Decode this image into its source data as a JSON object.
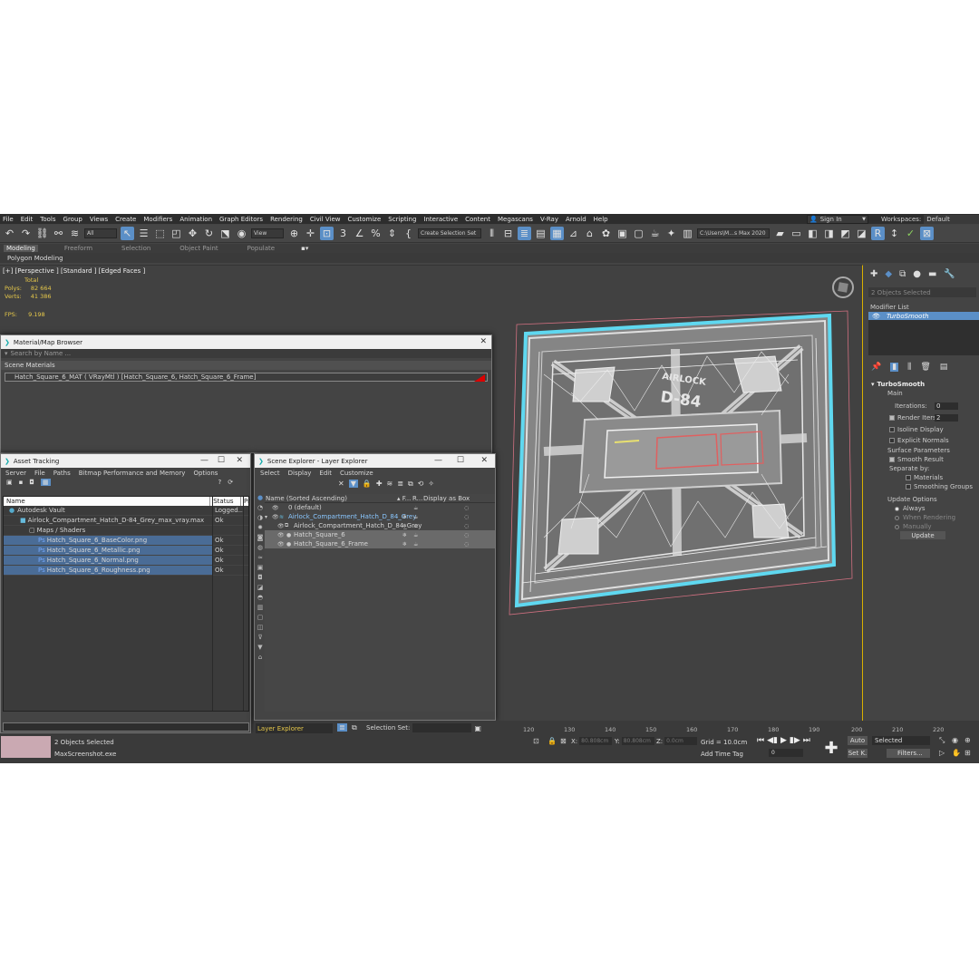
{
  "menu": [
    "File",
    "Edit",
    "Tools",
    "Group",
    "Views",
    "Create",
    "Modifiers",
    "Animation",
    "Graph Editors",
    "Rendering",
    "Civil View",
    "Customize",
    "Scripting",
    "Interactive",
    "Content",
    "Megascans",
    "V-Ray",
    "Arnold",
    "Help"
  ],
  "account": {
    "signin": "Sign In",
    "workspaces_label": "Workspaces:",
    "workspace": "Default"
  },
  "toolbar": {
    "filter_value": "All",
    "view_value": "View",
    "selection_set_placeholder": "Create Selection Set",
    "project_path": "C:\\Users\\M...s Max 2020"
  },
  "ribbon": {
    "tabs": [
      "Modeling",
      "Freeform",
      "Selection",
      "Object Paint",
      "Populate"
    ],
    "panel": "Polygon Modeling"
  },
  "viewport": {
    "label": "[+] [Perspective ] [Standard ] [Edged Faces ]",
    "stats": {
      "total_label": "Total",
      "polys_label": "Polys:",
      "polys": "82 664",
      "verts_label": "Verts:",
      "verts": "41 386"
    },
    "fps_label": "FPS:",
    "fps": "9.198",
    "model_text_1": "AIRLOCK",
    "model_text_2": "D-84"
  },
  "material_browser": {
    "title": "Material/Map Browser",
    "search_placeholder": "Search by Name ...",
    "section": "Scene Materials",
    "item": "Hatch_Square_6_MAT  ( VRayMtl )  [Hatch_Square_6, Hatch_Square_6_Frame]"
  },
  "asset_tracking": {
    "title": "Asset Tracking",
    "menu": [
      "Server",
      "File",
      "Paths",
      "Bitmap Performance and Memory",
      "Options"
    ],
    "columns": [
      "Name",
      "Status",
      "Pr"
    ],
    "rows": [
      {
        "name": "Autodesk Vault",
        "status": "Logged..."
      },
      {
        "name": "Airlock_Compartment_Hatch_D-84_Grey_max_vray.max",
        "status": "Ok"
      },
      {
        "name": "Maps / Shaders",
        "status": ""
      },
      {
        "name": "Hatch_Square_6_BaseColor.png",
        "status": "Ok"
      },
      {
        "name": "Hatch_Square_6_Metallic.png",
        "status": "Ok"
      },
      {
        "name": "Hatch_Square_6_Normal.png",
        "status": "Ok"
      },
      {
        "name": "Hatch_Square_6_Roughness.png",
        "status": "Ok"
      }
    ]
  },
  "scene_explorer": {
    "title": "Scene Explorer - Layer Explorer",
    "menu": [
      "Select",
      "Display",
      "Edit",
      "Customize"
    ],
    "columns": [
      "Name (Sorted Ascending)",
      "▴ F...",
      "R...",
      "Display as Box"
    ],
    "rows": [
      {
        "name": "0 (default)"
      },
      {
        "name": "Airlock_Compartment_Hatch_D_84_Grey"
      },
      {
        "name": "Airlock_Compartment_Hatch_D_84_Grey"
      },
      {
        "name": "Hatch_Square_6"
      },
      {
        "name": "Hatch_Square_6_Frame"
      }
    ],
    "footer_label": "Layer Explorer",
    "selection_set_label": "Selection Set:"
  },
  "command_panel": {
    "selection": "2 Objects Selected",
    "modifier_list": "Modifier List",
    "stack_item": "TurboSmooth",
    "rollout_title": "TurboSmooth",
    "main_label": "Main",
    "iterations_label": "Iterations:",
    "iterations": "0",
    "render_iters_label": "Render Iters:",
    "render_iters": "2",
    "isoline": "Isoline Display",
    "explicit": "Explicit Normals",
    "surface_params": "Surface Parameters",
    "smooth_result": "Smooth Result",
    "separate_by": "Separate by:",
    "materials": "Materials",
    "smoothing_groups": "Smoothing Groups",
    "update_options": "Update Options",
    "always": "Always",
    "when_rendering": "When Rendering",
    "manually": "Manually",
    "update_btn": "Update"
  },
  "timeline": {
    "ticks": [
      "120",
      "130",
      "140",
      "150",
      "160",
      "170",
      "180",
      "190",
      "200",
      "210",
      "220"
    ]
  },
  "status": {
    "selected": "2 Objects Selected",
    "prompt": "MaxScreenshot.exe",
    "x_label": "X:",
    "x": "80.808cm",
    "y_label": "Y:",
    "y": "80.808cm",
    "z_label": "Z:",
    "z": "0.0cm",
    "grid": "Grid = 10.0cm",
    "add_time_tag": "Add Time Tag",
    "frame": "0",
    "auto": "Auto",
    "set_key": "Set K.",
    "key_filter": "Selected",
    "filters": "Filters..."
  }
}
